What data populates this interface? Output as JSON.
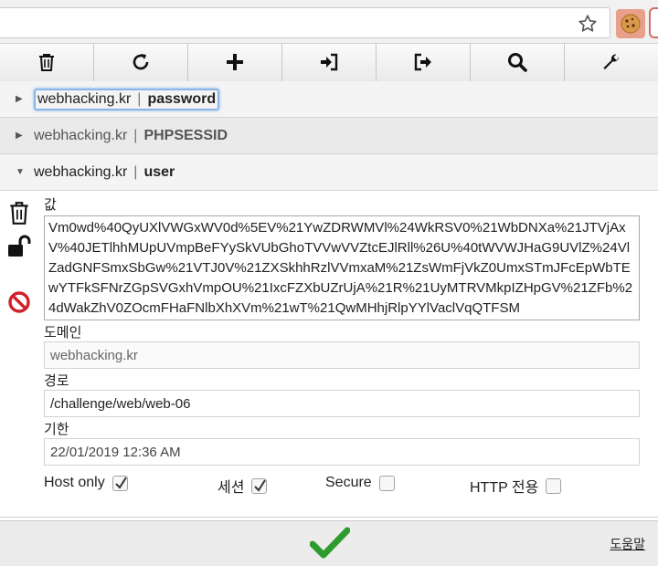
{
  "browser": {
    "extension_icon": "cookie-icon",
    "star_icon": "star-icon"
  },
  "toolbar": {
    "buttons": [
      {
        "name": "delete-all-button",
        "icon": "trash-icon"
      },
      {
        "name": "reset-button",
        "icon": "refresh-icon"
      },
      {
        "name": "add-button",
        "icon": "plus-icon"
      },
      {
        "name": "import-button",
        "icon": "import-icon"
      },
      {
        "name": "export-button",
        "icon": "export-icon"
      },
      {
        "name": "search-button",
        "icon": "search-icon"
      },
      {
        "name": "settings-button",
        "icon": "wrench-icon"
      }
    ]
  },
  "cookies": [
    {
      "domain": "webhacking.kr",
      "separator": "|",
      "name": "password",
      "expanded": false
    },
    {
      "domain": "webhacking.kr",
      "separator": "|",
      "name": "PHPSESSID",
      "expanded": false
    },
    {
      "domain": "webhacking.kr",
      "separator": "|",
      "name": "user",
      "expanded": true
    }
  ],
  "detail": {
    "value_label": "값",
    "value": "Vm0wd%40QyUXlVWGxWV0d%5EV%21YwZDRWMVl%24WkRSV0%21WbDNXa%21JTVjAxV%40JETlhhMUpUVmpBeFYySkVUbGhoTVVwVVZtcEJlRll%26U%40tWVWJHaG9UVlZ%24VlZadGNFSmxSbGw%21VTJ0V%21ZXSkhhRzlVVmxaM%21ZsWmFjVkZ0UmxSTmJFcEpWbTEwYTFkSFNrZGpSVGxhVmpOU%21IxcFZXbUZrUjA%21R%21UyMTRVMkpIZHpGV%21ZFb%24dWakZhV0ZOcmFHaFNlbXhXVm%21wT%21QwMHhjRlpYYlVaclVqQTFSM",
    "domain_label": "도메인",
    "domain": "webhacking.kr",
    "path_label": "경로",
    "path": "/challenge/web/web-06",
    "expiry_label": "기한",
    "expiry": "22/01/2019 12:36 AM",
    "host_only_label": "Host only",
    "host_only": true,
    "session_label": "세션",
    "session": true,
    "secure_label": "Secure",
    "secure": false,
    "http_only_label": "HTTP 전용",
    "http_only": false
  },
  "footer": {
    "help_label": "도움말"
  },
  "colors": {
    "save_check": "#2e9b2e",
    "block_icon": "#d0222a",
    "focus_ring": "#8ab4e8"
  }
}
